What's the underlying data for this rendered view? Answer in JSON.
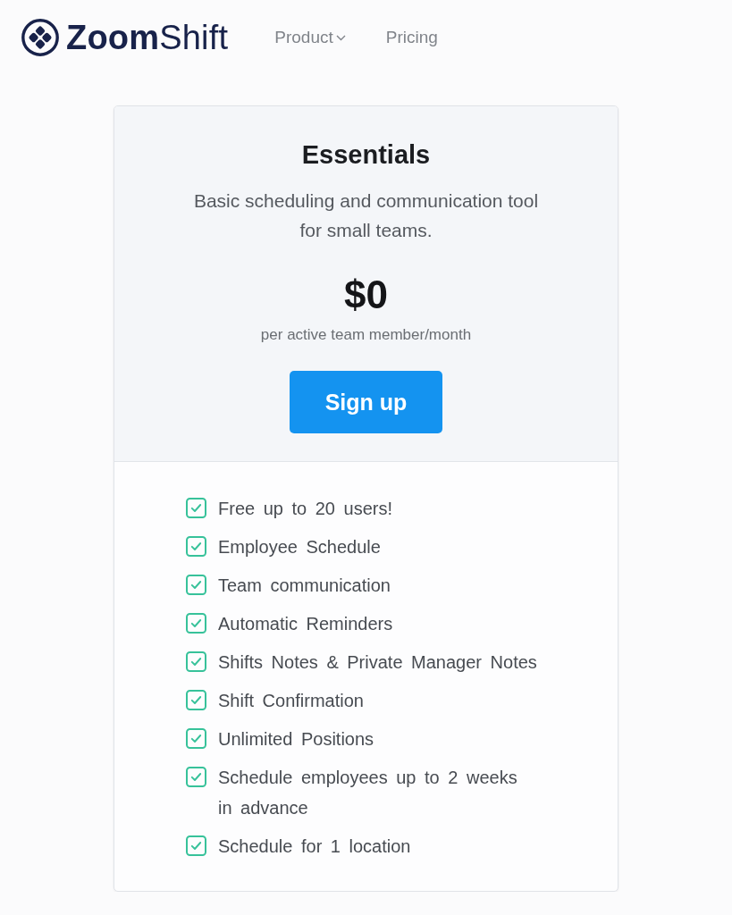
{
  "header": {
    "logo": "**Zoom**Shift",
    "nav": [
      {
        "label": "Product",
        "dropdown": true
      },
      {
        "label": "Pricing",
        "dropdown": false
      }
    ]
  },
  "plan": {
    "name": "Essentials",
    "description": "Basic scheduling and communication tool for small teams.",
    "price": "$0",
    "price_note": "per active team member/month",
    "button": "Sign up",
    "features": [
      {
        "label": "Free up to 20 users!",
        "checked": true
      },
      {
        "label": "Employee Schedule",
        "checked": true
      },
      {
        "label": "Team communication",
        "checked": true
      },
      {
        "label": "Automatic Reminders",
        "checked": true
      },
      {
        "label": "Shifts Notes & Private Manager Notes",
        "checked": true
      },
      {
        "label": "Shift Confirmation",
        "checked": true
      },
      {
        "label": "Unlimited Positions",
        "checked": true
      },
      {
        "label": "Schedule employees up to 2 weeks in advance",
        "checked": true
      },
      {
        "label": "Schedule for 1 location",
        "checked": true
      }
    ]
  }
}
